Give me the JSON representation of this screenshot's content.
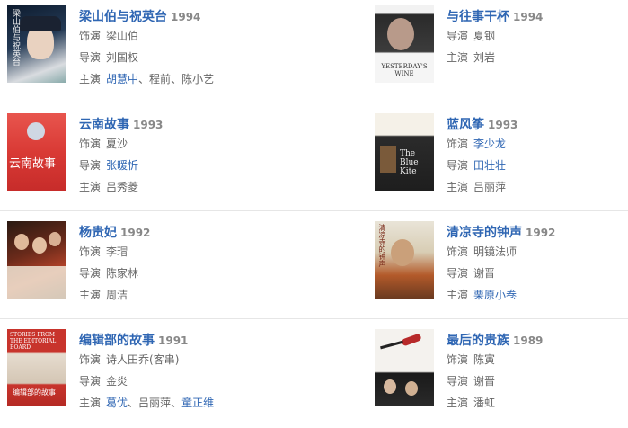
{
  "labels": {
    "role": "饰演",
    "director": "导演",
    "cast": "主演"
  },
  "films": [
    {
      "title": "梁山伯与祝英台",
      "year": "1994",
      "role": "梁山伯",
      "director": [
        {
          "t": "刘国权",
          "link": false
        }
      ],
      "cast": [
        {
          "t": "胡慧中",
          "link": true
        },
        {
          "t": "程前",
          "link": false
        },
        {
          "t": "陈小艺",
          "link": false
        }
      ]
    },
    {
      "title": "与往事干杯",
      "year": "1994",
      "role": "夏钢",
      "director": [
        {
          "t": "刘岩",
          "link": false
        }
      ],
      "cast": []
    },
    {
      "title": "云南故事",
      "year": "1993",
      "role": "夏沙",
      "director": [
        {
          "t": "张暖忻",
          "link": true
        }
      ],
      "cast": [
        {
          "t": "吕秀菱",
          "link": false
        }
      ]
    },
    {
      "title": "蓝风筝",
      "year": "1993",
      "role": "李少龙",
      "roleLink": true,
      "director": [
        {
          "t": "田壮壮",
          "link": true
        }
      ],
      "cast": [
        {
          "t": "吕丽萍",
          "link": false
        }
      ]
    },
    {
      "title": "杨贵妃",
      "year": "1992",
      "role": "李瑁",
      "director": [
        {
          "t": "陈家林",
          "link": false
        }
      ],
      "cast": [
        {
          "t": "周洁",
          "link": false
        }
      ]
    },
    {
      "title": "清凉寺的钟声",
      "year": "1992",
      "role": "明镜法师",
      "director": [
        {
          "t": "谢晋",
          "link": false
        }
      ],
      "cast": [
        {
          "t": "栗原小卷",
          "link": true
        }
      ]
    },
    {
      "title": "编辑部的故事",
      "year": "1991",
      "role": "诗人田乔(客串)",
      "director": [
        {
          "t": "金炎",
          "link": false
        }
      ],
      "cast": [
        {
          "t": "葛优",
          "link": true
        },
        {
          "t": "吕丽萍",
          "link": false
        },
        {
          "t": "童正维",
          "link": true
        }
      ]
    },
    {
      "title": "最后的贵族",
      "year": "1989",
      "role": "陈寅",
      "director": [
        {
          "t": "谢晋",
          "link": false
        }
      ],
      "cast": [
        {
          "t": "潘虹",
          "link": false
        }
      ]
    }
  ],
  "posterText": {
    "p0": "梁山伯与祝英台",
    "p1": "YESTERDAY'S WINE",
    "p2": "云南故事",
    "p3": "The Blue Kite",
    "p5": "清凉寺的钟声",
    "p6": "STORIES FROM THE EDITORIAL BOARD",
    "p6b": "编辑部的故事"
  },
  "colors": {
    "link": "#2f66b3",
    "year": "#888888",
    "text": "#666666",
    "separator": "#e6e6e6"
  }
}
